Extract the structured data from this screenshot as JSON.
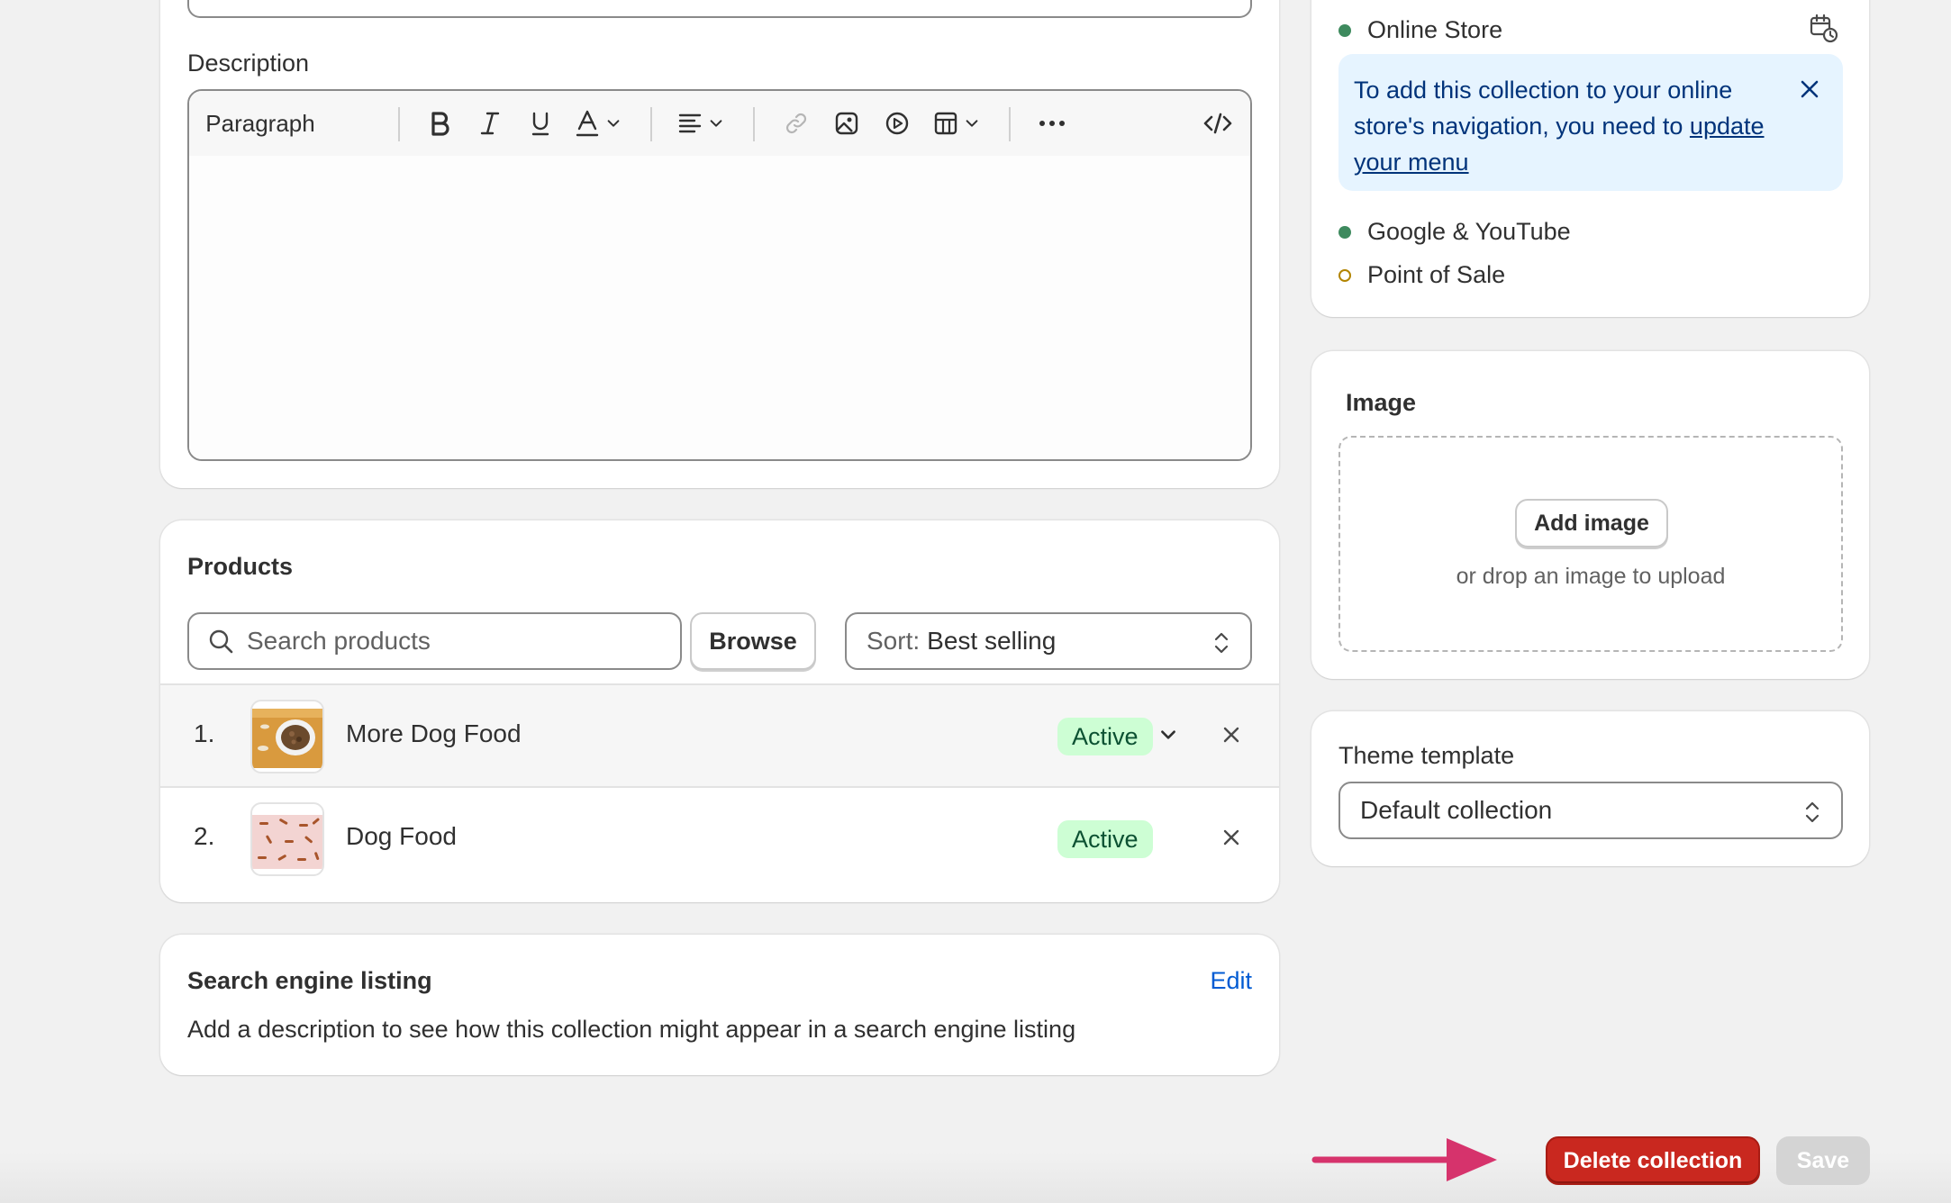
{
  "description": {
    "label": "Description",
    "toolbar": {
      "paragraph_label": "Paragraph"
    }
  },
  "products": {
    "heading": "Products",
    "search_placeholder": "Search products",
    "browse_label": "Browse",
    "sort_prefix": "Sort:",
    "sort_value": "Best selling",
    "rows": [
      {
        "index": "1.",
        "name": "More Dog Food",
        "status": "Active"
      },
      {
        "index": "2.",
        "name": "Dog Food",
        "status": "Active"
      }
    ]
  },
  "seo": {
    "heading": "Search engine listing",
    "edit_label": "Edit",
    "description": "Add a description to see how this collection might appear in a search engine listing"
  },
  "channels": {
    "online_store": "Online Store",
    "banner_text": "To add this collection to your online store's navigation, you need to",
    "banner_link": "update your menu",
    "google": "Google & YouTube",
    "pos": "Point of Sale"
  },
  "image": {
    "heading": "Image",
    "add_label": "Add image",
    "drop_hint": "or drop an image to upload"
  },
  "theme": {
    "label": "Theme template",
    "value": "Default collection"
  },
  "footer": {
    "delete_label": "Delete collection",
    "save_label": "Save"
  },
  "colors": {
    "active_badge_bg": "#cdfed4",
    "active_badge_text": "#0c5132",
    "delete_button": "#c9281f",
    "annotation_arrow": "#d6336c",
    "link": "#005bd3",
    "banner_bg": "#e6f4ff"
  }
}
